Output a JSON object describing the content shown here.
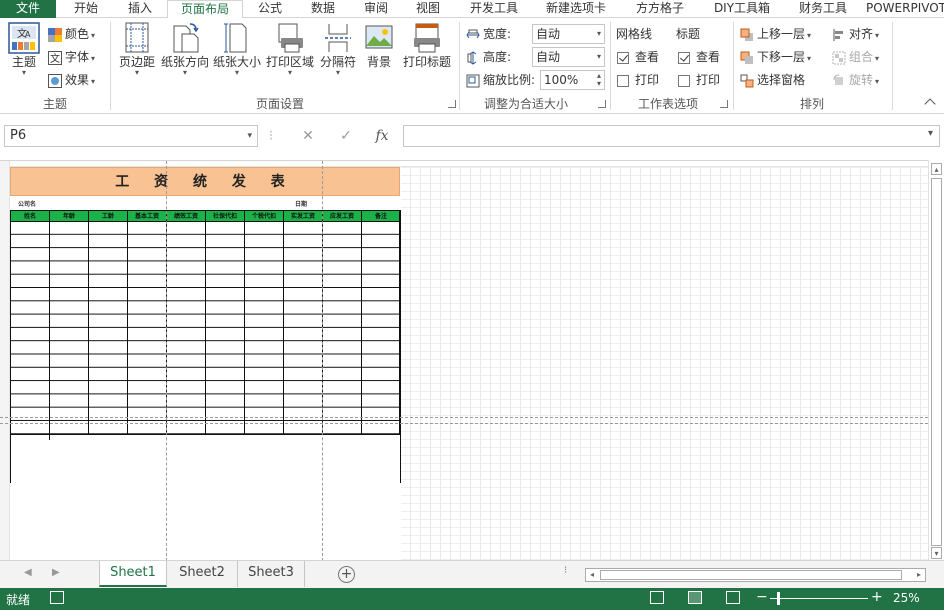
{
  "tabs": [
    "文件",
    "开始",
    "插入",
    "页面布局",
    "公式",
    "数据",
    "审阅",
    "视图",
    "开发工具",
    "新建选项卡",
    "方方格子",
    "DIY工具箱",
    "财务工具",
    "POWERPIVOT"
  ],
  "active_tab": "页面布局",
  "ribbon": {
    "theme": {
      "theme_label": "主题",
      "colors_label": "颜色",
      "fonts_label": "字体",
      "effects_label": "效果",
      "group_label": "主题"
    },
    "page_setup": {
      "margins_label": "页边距",
      "orientation_label": "纸张方向",
      "size_label": "纸张大小",
      "print_area_label": "打印区域",
      "breaks_label": "分隔符",
      "background_label": "背景",
      "print_titles_label": "打印标题",
      "group_label": "页面设置"
    },
    "scale": {
      "width_label": "宽度:",
      "width_value": "自动",
      "height_label": "高度:",
      "height_value": "自动",
      "scale_label": "缩放比例:",
      "scale_value": "100%",
      "group_label": "调整为合适大小"
    },
    "sheet_options": {
      "gridlines_label": "网格线",
      "headings_label": "标题",
      "gridlines_view_label": "查看",
      "gridlines_print_label": "打印",
      "headings_view_label": "查看",
      "headings_print_label": "打印",
      "gridlines_view_checked": true,
      "gridlines_print_checked": false,
      "headings_view_checked": true,
      "headings_print_checked": false,
      "group_label": "工作表选项"
    },
    "arrange": {
      "bring_forward_label": "上移一层",
      "send_backward_label": "下移一层",
      "selection_pane_label": "选择窗格",
      "align_label": "对齐",
      "group_obj_label": "组合",
      "rotate_label": "旋转",
      "group_label": "排列"
    }
  },
  "formula_bar": {
    "name_box": "P6",
    "cancel_icon": "✕",
    "enter_icon": "✓",
    "fx_label": "fx",
    "formula": ""
  },
  "sheet": {
    "title": "工 资 统 发 表",
    "company_label": "公司名",
    "date_label": "日期",
    "headers": [
      "姓名",
      "年龄",
      "工龄",
      "基本工资",
      "绩效工资",
      "社保代扣",
      "个税代扣",
      "实发工资",
      "应发工资",
      "备注"
    ],
    "header_fill": "#1bb249",
    "title_fill": "#f8c293"
  },
  "sheet_tabs": [
    "Sheet1",
    "Sheet2",
    "Sheet3"
  ],
  "active_sheet": "Sheet1",
  "status": {
    "ready": "就绪",
    "zoom": "25%"
  },
  "colors": {
    "accent": "#217346"
  }
}
